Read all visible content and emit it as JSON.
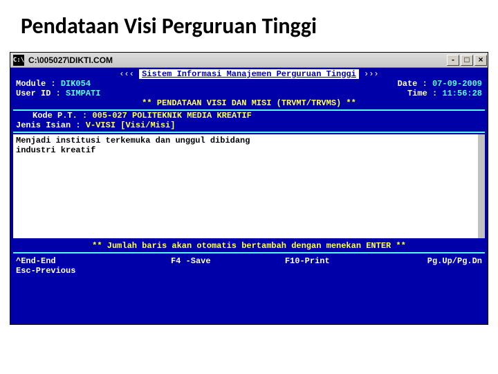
{
  "slide": {
    "title": "Pendataan Visi Perguruan Tinggi"
  },
  "window": {
    "sysicon_text": "C:\\",
    "title": "C:\\005027\\DIKTI.COM",
    "btn_min": "-",
    "btn_max": "□",
    "btn_close": "×"
  },
  "banner": {
    "left_arrows": "‹‹‹",
    "text": "Sistem Informasi Manajemen Perguruan Tinggi",
    "right_arrows": "›››"
  },
  "header": {
    "module_label": "Module  :",
    "module_value": "DIK054",
    "userid_label": "User ID :",
    "userid_value": "SIMPATI",
    "date_label": "Date :",
    "date_value": "07-09-2009",
    "time_label": "Time :",
    "time_value": "11:56:28"
  },
  "subtitle": "** PENDATAAN VISI DAN MISI (TRVMT/TRVMS) **",
  "codes": {
    "pt_label": "Kode P.T.   :",
    "pt_value": "005-027 POLITEKNIK MEDIA KREATIF",
    "jenis_label": "Jenis Isian :",
    "jenis_value": "V-VISI   [Visi/Misi]"
  },
  "input_text": "Menjadi institusi terkemuka dan unggul dibidang\nindustri kreatif",
  "notice": "** Jumlah baris akan otomatis bertambah dengan menekan ENTER **",
  "footer": {
    "end": "^End-End",
    "esc": " Esc-Previous",
    "save": "F4 -Save",
    "print": "F10-Print",
    "page": "Pg.Up/Pg.Dn"
  }
}
